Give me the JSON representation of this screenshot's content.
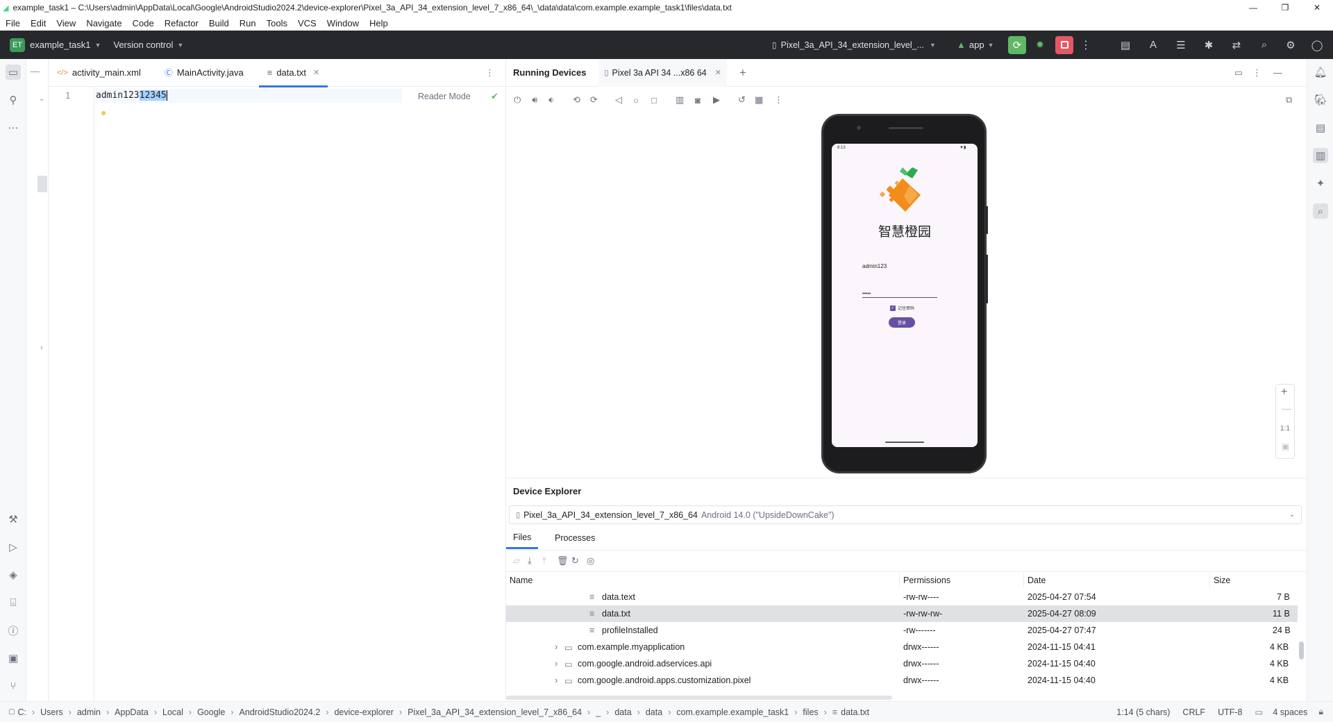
{
  "window": {
    "title": "example_task1 – C:\\Users\\admin\\AppData\\Local\\Google\\AndroidStudio2024.2\\device-explorer\\Pixel_3a_API_34_extension_level_7_x86_64\\_\\data\\data\\com.example.example_task1\\files\\data.txt",
    "minimize": "—",
    "maximize": "❐",
    "close": "✕"
  },
  "menu": [
    "File",
    "Edit",
    "View",
    "Navigate",
    "Code",
    "Refactor",
    "Build",
    "Run",
    "Tools",
    "VCS",
    "Window",
    "Help"
  ],
  "toolbar": {
    "project_badge": "ET",
    "project_name": "example_task1",
    "version_control": "Version control",
    "device": "Pixel_3a_API_34_extension_level_...",
    "run_config": "app"
  },
  "editor": {
    "tabs": [
      {
        "label": "activity_main.xml"
      },
      {
        "label": "MainActivity.java"
      },
      {
        "label": "data.txt"
      }
    ],
    "line_number": "1",
    "code_plain": "admin123",
    "code_selected": "12345",
    "reader_mode": "Reader Mode"
  },
  "running_devices": {
    "title": "Running Devices",
    "tab_label": "Pixel 3a API 34 ...x86 64",
    "zoom_ratio": "1:1"
  },
  "phone_app": {
    "status_time": "8:13",
    "app_title": "智慧橙园",
    "username": "admin123",
    "password_mask": "•••••",
    "remember_label": "记住密码",
    "login_button": "登录"
  },
  "device_explorer": {
    "title": "Device Explorer",
    "device_name": "Pixel_3a_API_34_extension_level_7_x86_64",
    "device_os": "Android 14.0 (\"UpsideDownCake\")",
    "tabs": [
      "Files",
      "Processes"
    ],
    "columns": {
      "name": "Name",
      "permissions": "Permissions",
      "date": "Date",
      "size": "Size"
    },
    "rows": [
      {
        "name": "data.text",
        "perm": "-rw-rw----",
        "date": "2025-04-27 07:54",
        "size": "7 B",
        "type": "file"
      },
      {
        "name": "data.txt",
        "perm": "-rw-rw-rw-",
        "date": "2025-04-27 08:09",
        "size": "11 B",
        "type": "file"
      },
      {
        "name": "profileInstalled",
        "perm": "-rw-------",
        "date": "2025-04-27 07:47",
        "size": "24 B",
        "type": "file"
      },
      {
        "name": "com.example.myapplication",
        "perm": "drwx------",
        "date": "2024-11-15 04:41",
        "size": "4 KB",
        "type": "folder"
      },
      {
        "name": "com.google.android.adservices.api",
        "perm": "drwx------",
        "date": "2024-11-15 04:40",
        "size": "4 KB",
        "type": "folder"
      },
      {
        "name": "com.google.android.apps.customization.pixel",
        "perm": "drwx------",
        "date": "2024-11-15 04:40",
        "size": "4 KB",
        "type": "folder"
      }
    ]
  },
  "statusbar": {
    "breadcrumbs": [
      "C:",
      "Users",
      "admin",
      "AppData",
      "Local",
      "Google",
      "AndroidStudio2024.2",
      "device-explorer",
      "Pixel_3a_API_34_extension_level_7_x86_64",
      "_",
      "data",
      "data",
      "com.example.example_task1",
      "files",
      "data.txt"
    ],
    "position": "1:14 (5 chars)",
    "line_sep": "CRLF",
    "encoding": "UTF-8",
    "indent": "4 spaces"
  },
  "colors": {
    "accent": "#3574f0",
    "toolbar_bg": "#27282c",
    "run_green": "#5fb865",
    "stop_red": "#e55765",
    "selection": "#a6d2ff",
    "orange": "#f28c1c",
    "leaf": "#2fa84f",
    "purple_button": "#6750a4"
  }
}
